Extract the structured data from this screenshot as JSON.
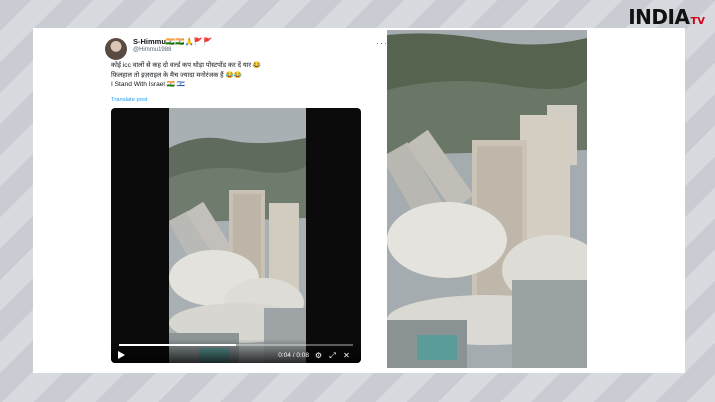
{
  "logo": {
    "brand": "INDIA",
    "suffix": "TV"
  },
  "tweet": {
    "display_name": "S-Himmu🇮🇳🇮🇳🙏🚩🚩",
    "handle": "@Himmu1988",
    "more_icon": "more-dots-icon",
    "lines": [
      "कोई icc वालों से कह दो वर्ल्ड कप थोड़ा पोस्टपोंड कर दें यार 😂",
      "फ़िलहाल तो इज़राइल के मैच ज्यादा मनोरंजक हैं 😂😂",
      "I Stand With Israel 🇮🇳 🇮🇱"
    ],
    "translate_label": "Translate post"
  },
  "video": {
    "time": "0:04 / 0:08",
    "progress_fraction": 0.5,
    "icons": [
      "play-icon",
      "settings-icon",
      "fullscreen-icon",
      "close-icon"
    ]
  },
  "colors": {
    "link": "#1d9bf0",
    "brand_red": "#d0021b"
  }
}
